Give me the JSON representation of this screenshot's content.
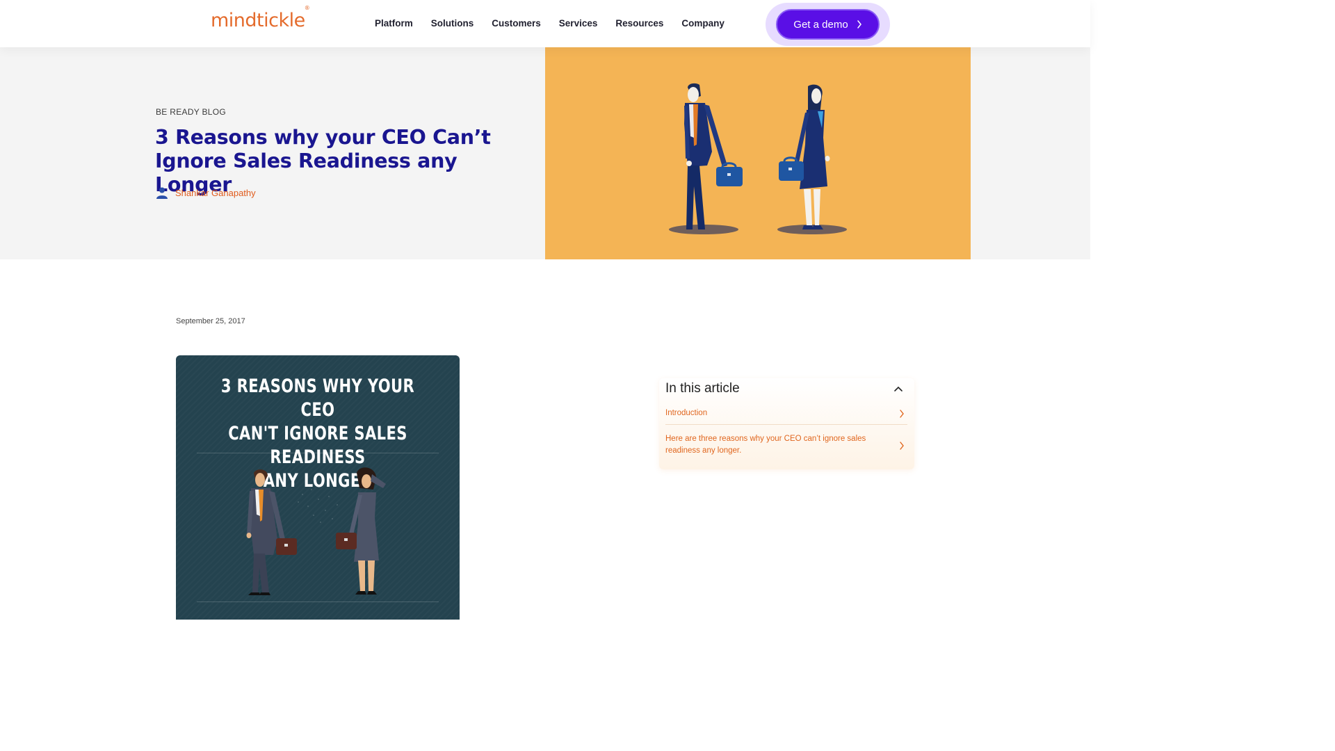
{
  "header": {
    "logo_text": "mindtickle",
    "logo_mark": "®",
    "nav": [
      "Platform",
      "Solutions",
      "Customers",
      "Services",
      "Resources",
      "Company"
    ],
    "cta_label": "Get a demo"
  },
  "hero": {
    "eyebrow": "BE READY BLOG",
    "title": "3 Reasons why your CEO Can’t Ignore Sales Readiness any Longer",
    "author": "Shankar Ganapathy",
    "image_bg": "#f4b455"
  },
  "article": {
    "date": "September 25, 2017",
    "image_title_lines": [
      "3 REASONS WHY YOUR CEO",
      "CAN'T IGNORE SALES READINESS",
      "ANY LONGER"
    ]
  },
  "toc": {
    "heading": "In this article",
    "items": [
      "Introduction",
      "Here are three reasons why your CEO can’t ignore sales readiness any longer."
    ]
  },
  "colors": {
    "brand_orange": "#e46b2c",
    "title_navy": "#1a1690",
    "cta_purple": "#5a0fe6"
  }
}
